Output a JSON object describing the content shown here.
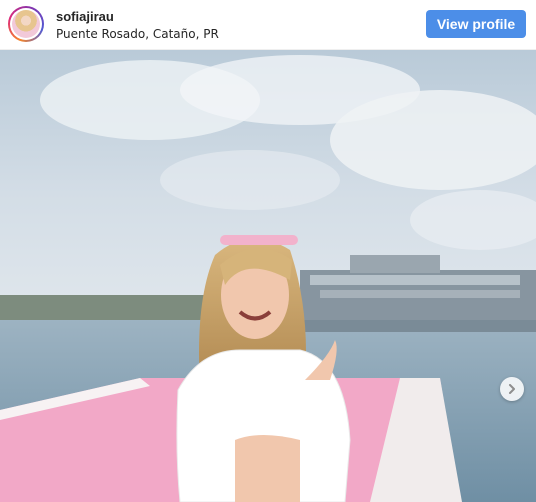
{
  "post": {
    "username": "sofiajirau",
    "location": "Puente Rosado, Cataño, PR",
    "view_profile_label": "View profile"
  },
  "icons": {
    "avatar": "profile-avatar",
    "next": "chevron-right-icon"
  },
  "colors": {
    "button": "#4c8ee8",
    "pier": "#f2a8c7",
    "sky": "#c9d7e2",
    "water": "#7f9db0"
  }
}
